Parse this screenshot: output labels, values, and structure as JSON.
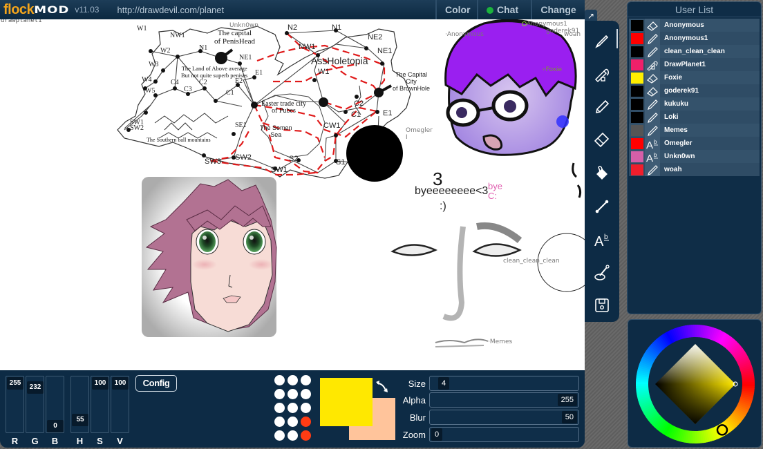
{
  "app": {
    "logo_part1": "flock",
    "logo_part2": "MOD",
    "version": "v11.03",
    "room_url": "http://drawdevil.com/planet"
  },
  "top_tabs": {
    "color": "Color",
    "chat": "Chat",
    "change": "Change",
    "chat_status_color": "#1bb33c"
  },
  "canvas": {
    "corner_label": "drawplanet1",
    "map_labels": {
      "capital_penishead": [
        "The capital",
        "of PenisHead"
      ],
      "land_above": [
        "The Land of Above average",
        "But not quite superb penises"
      ],
      "assholetopia": "AssHoletopia",
      "capital_brownhole": [
        "The Capital",
        "City",
        "of BrownHole"
      ],
      "easter_trade": [
        "Easter trade city",
        "of Pubes"
      ],
      "semen_sea": [
        "The Semen",
        "Sea"
      ],
      "ball_mountains": "The Southern ball mountains",
      "nodes_left": [
        "W1",
        "NW1",
        "N1",
        "NE1",
        "W2",
        "W3",
        "W4",
        "W5",
        "C4",
        "C3",
        "C2",
        "C1",
        "E2",
        "E1",
        "SW1",
        "SW2",
        "SE1"
      ],
      "nodes_right": [
        "N2",
        "N1",
        "NE2",
        "NW1",
        "W1",
        "NE1",
        "C2",
        "C1",
        "E1",
        "CW1",
        "S2",
        "S1",
        "SW1",
        "SW2",
        "SW3"
      ]
    },
    "text_drawings": {
      "bye_main": "byeeeeeeee<3",
      "bye_smile": ":)",
      "bye_heart_3": "3",
      "bye_pink": [
        "bye",
        "C:"
      ]
    },
    "cursors": [
      {
        "name": "Unkn0wn"
      },
      {
        "name": "Anonymous"
      },
      {
        "name": "Anonymous1"
      },
      {
        "name": "goderek91"
      },
      {
        "name": "woah"
      },
      {
        "name": "Foxie"
      },
      {
        "name": "Omegler"
      },
      {
        "name": "clean_clean_clean"
      },
      {
        "name": "Memes"
      }
    ]
  },
  "tools": [
    {
      "name": "brush",
      "active": true
    },
    {
      "name": "smudge",
      "active": false
    },
    {
      "name": "pencil",
      "active": false
    },
    {
      "name": "eraser",
      "active": false
    },
    {
      "name": "fill",
      "active": false
    },
    {
      "name": "line",
      "active": false
    },
    {
      "name": "text",
      "active": false
    },
    {
      "name": "eyedropper",
      "active": false
    },
    {
      "name": "save",
      "active": false
    }
  ],
  "userlist": {
    "title": "User List",
    "users": [
      {
        "name": "Anonymous",
        "color": "#000000",
        "tool": "eraser"
      },
      {
        "name": "Anonymous1",
        "color": "#ff0000",
        "tool": "brush"
      },
      {
        "name": "clean_clean_clean",
        "color": "#000000",
        "tool": "brush"
      },
      {
        "name": "DrawPlanet1",
        "color": "#f0206a",
        "tool": "smudge"
      },
      {
        "name": "Foxie",
        "color": "#ffee00",
        "tool": "eraser"
      },
      {
        "name": "goderek91",
        "color": "#000000",
        "tool": "eraser"
      },
      {
        "name": "kukuku",
        "color": "#000000",
        "tool": "brush"
      },
      {
        "name": "Loki",
        "color": "#000000",
        "tool": "brush"
      },
      {
        "name": "Memes",
        "color": "#555555",
        "tool": "brush"
      },
      {
        "name": "Omegler",
        "color": "#ff0000",
        "tool": "text"
      },
      {
        "name": "Unkn0wn",
        "color": "#d65fa8",
        "tool": "text"
      },
      {
        "name": "woah",
        "color": "#f01e2c",
        "tool": "brush"
      }
    ]
  },
  "color_channels": [
    {
      "label": "R",
      "value": "255",
      "fraction": 1.0
    },
    {
      "label": "G",
      "value": "232",
      "fraction": 0.91
    },
    {
      "label": "B",
      "value": "0",
      "fraction": 0.0
    },
    {
      "label": "H",
      "value": "55",
      "fraction": 0.15
    },
    {
      "label": "S",
      "value": "100",
      "fraction": 1.0
    },
    {
      "label": "V",
      "value": "100",
      "fraction": 1.0
    }
  ],
  "config_label": "Config",
  "brush_presets": {
    "count": 15,
    "selected": [
      11,
      14
    ]
  },
  "colors": {
    "primary": "#ffe800",
    "secondary": "#ffc49b",
    "brush_selected": "#ff3c14"
  },
  "sliders": [
    {
      "label": "Size",
      "value": "4",
      "fraction": 0.0
    },
    {
      "label": "Alpha",
      "value": "255",
      "fraction": 1.0
    },
    {
      "label": "Blur",
      "value": "50",
      "fraction": 1.0
    },
    {
      "label": "Zoom",
      "value": "0",
      "fraction": 0.0
    }
  ],
  "color_wheel": {
    "hue_degrees": 55,
    "saturation": 1.0,
    "value": 1.0
  }
}
